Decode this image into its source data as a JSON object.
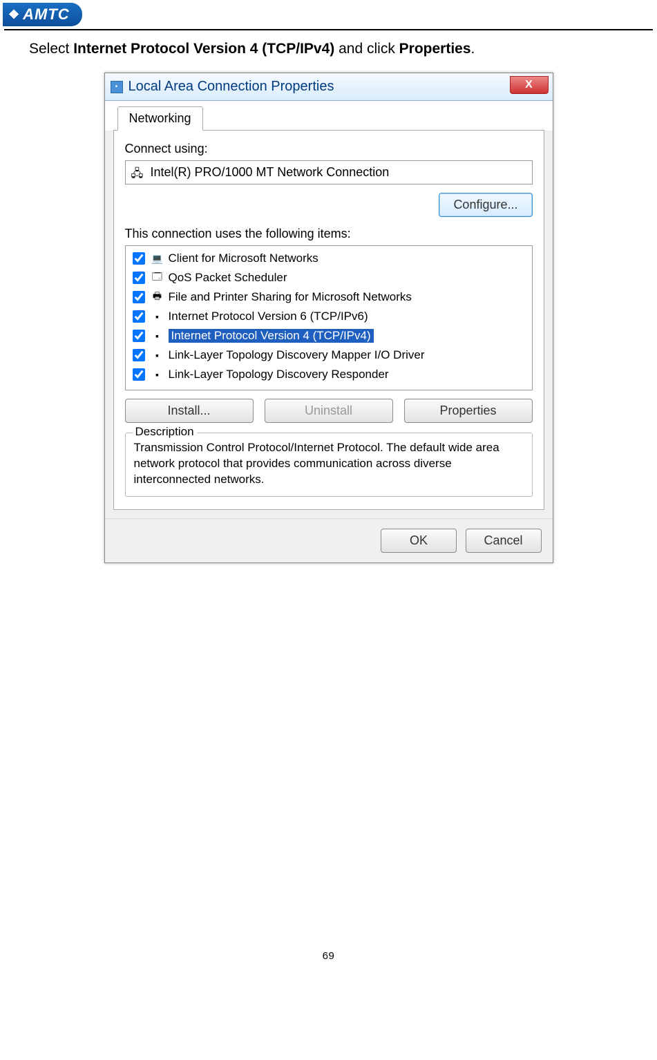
{
  "logo_text": "AMTC",
  "instruction": {
    "bullet": "",
    "pre": "Select ",
    "b1": "Internet Protocol Version 4 (TCP/IPv4)",
    "mid": " and click ",
    "b2": "Properties",
    "post": "."
  },
  "dialog": {
    "title": "Local Area Connection Properties",
    "close": "X",
    "tab": "Networking",
    "connect_label": "Connect using:",
    "adapter": "Intel(R) PRO/1000 MT Network Connection",
    "configure": "Configure...",
    "items_label": "This connection uses the following items:",
    "items": [
      {
        "label": "Client for Microsoft Networks",
        "checked": true,
        "selected": false,
        "icon": "💻"
      },
      {
        "label": "QoS Packet Scheduler",
        "checked": true,
        "selected": false,
        "icon": "🗔"
      },
      {
        "label": "File and Printer Sharing for Microsoft Networks",
        "checked": true,
        "selected": false,
        "icon": "🖶"
      },
      {
        "label": "Internet Protocol Version 6 (TCP/IPv6)",
        "checked": true,
        "selected": false,
        "icon": "▪"
      },
      {
        "label": "Internet Protocol Version 4 (TCP/IPv4)",
        "checked": true,
        "selected": true,
        "icon": "▪"
      },
      {
        "label": "Link-Layer Topology Discovery Mapper I/O Driver",
        "checked": true,
        "selected": false,
        "icon": "▪"
      },
      {
        "label": "Link-Layer Topology Discovery Responder",
        "checked": true,
        "selected": false,
        "icon": "▪"
      }
    ],
    "install": "Install...",
    "uninstall": "Uninstall",
    "properties": "Properties",
    "desc_title": "Description",
    "desc_text": "Transmission Control Protocol/Internet Protocol. The default wide area network protocol that provides communication across diverse interconnected networks.",
    "ok": "OK",
    "cancel": "Cancel"
  },
  "page_number": "69"
}
